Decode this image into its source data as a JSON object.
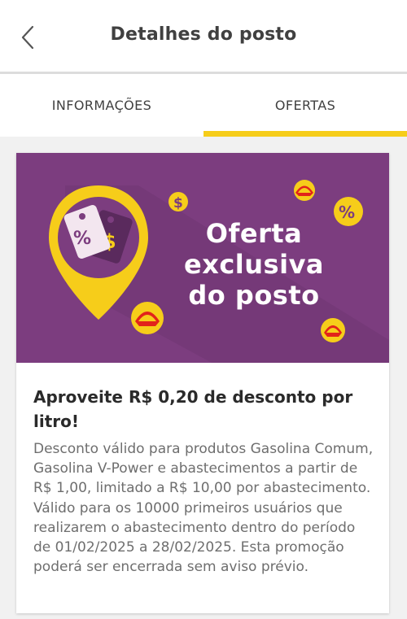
{
  "header": {
    "title": "Detalhes do posto",
    "back_icon": "chevron-left-icon"
  },
  "tabs": [
    {
      "label": "INFORMAÇÕES",
      "active": false
    },
    {
      "label": "OFERTAS",
      "active": true
    }
  ],
  "colors": {
    "accent": "#f6cd1a",
    "banner_bg": "#7c3d7f",
    "pin": "#f6cd1a",
    "tag_light": "#f3e6ef",
    "tag_dark": "#5a2a5d"
  },
  "offer": {
    "banner": {
      "line1": "Oferta",
      "line2": "exclusiva",
      "line3": "do posto",
      "icons": [
        "percent-tag-icon",
        "dollar-tag-icon",
        "dollar-coin-icon",
        "shell-coin-icon",
        "percent-coin-icon",
        "map-pin-icon"
      ]
    },
    "title": "Aproveite R$ 0,20 de desconto por litro!",
    "description": "Desconto válido para produtos Gasolina Comum, Gasolina V-Power e abastecimentos a partir de R$ 1,00, limitado a R$ 10,00 por abastecimento. Válido para os 10000 primeiros usuários que realizarem o abastecimento dentro do período de 01/02/2025 a 28/02/2025. Esta promoção poderá ser encerrada sem aviso prévio."
  }
}
